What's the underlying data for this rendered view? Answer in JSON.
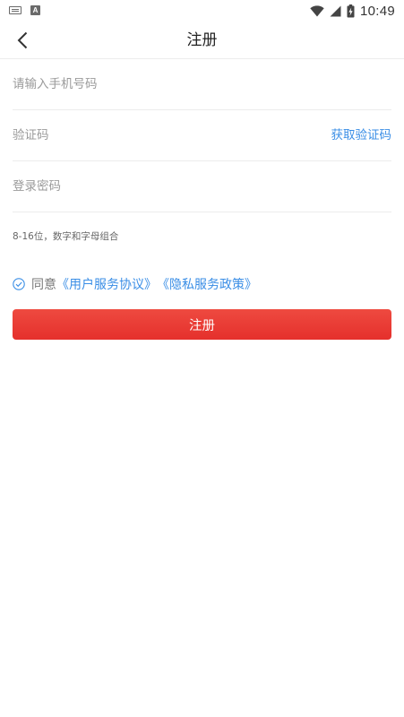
{
  "status_bar": {
    "time": "10:49",
    "icons": [
      "keyboard-icon",
      "a-notification-icon",
      "wifi-icon",
      "cell-signal-icon",
      "battery-charging-icon"
    ]
  },
  "header": {
    "title": "注册",
    "back_icon": "chevron-left-icon"
  },
  "form": {
    "phone_placeholder": "请输入手机号码",
    "code_placeholder": "验证码",
    "get_code_label": "获取验证码",
    "password_placeholder": "登录密码",
    "password_hint": "8-16位，数字和字母组合"
  },
  "agreement": {
    "prefix": "同意",
    "user_agreement": "《用户服务协议》",
    "privacy_policy": "《隐私服务政策》",
    "check_icon": "check-circle-icon"
  },
  "submit": {
    "label": "注册"
  },
  "colors": {
    "accent_blue": "#3a8ee6",
    "button_red": "#e8352f",
    "divider": "#ececec"
  }
}
